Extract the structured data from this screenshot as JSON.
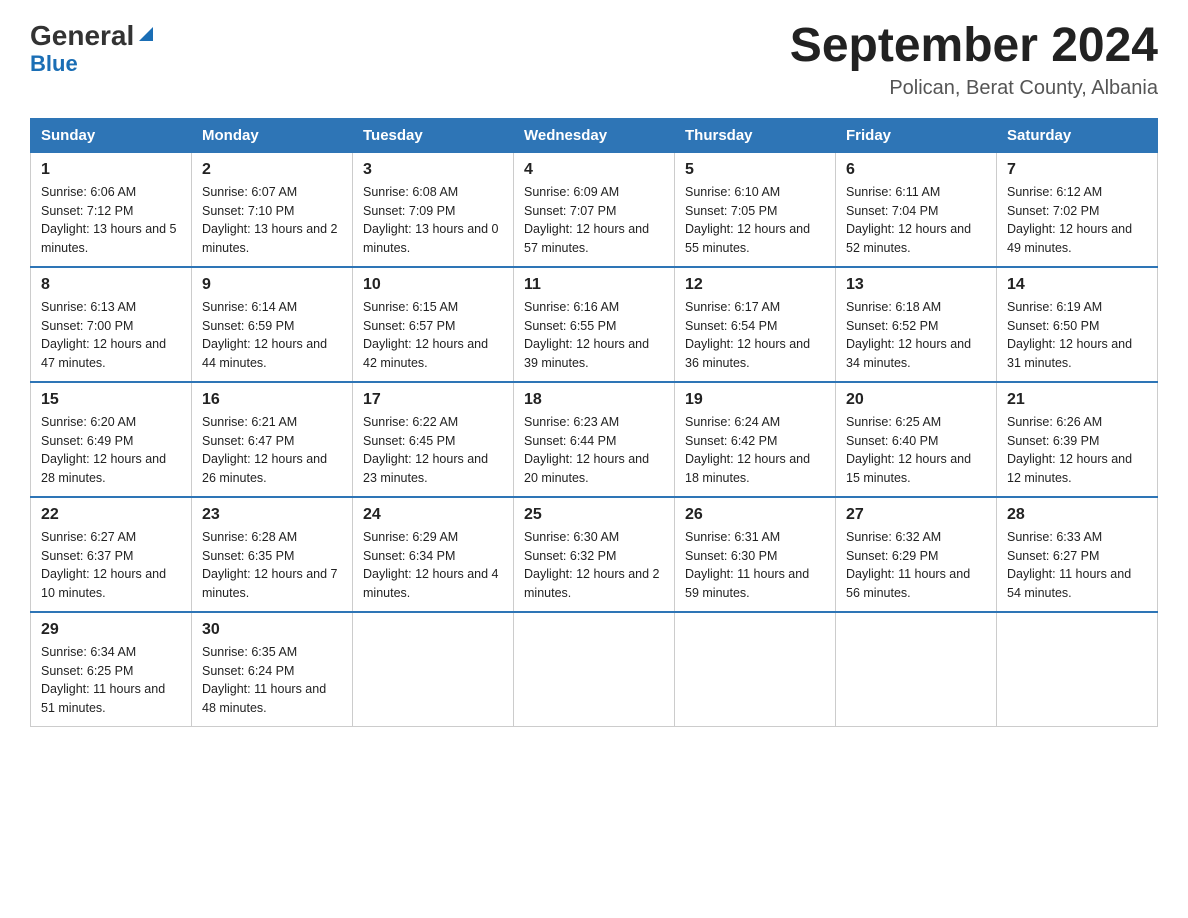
{
  "header": {
    "logo_general": "General",
    "logo_blue": "Blue",
    "title": "September 2024",
    "subtitle": "Polican, Berat County, Albania"
  },
  "calendar": {
    "days_of_week": [
      "Sunday",
      "Monday",
      "Tuesday",
      "Wednesday",
      "Thursday",
      "Friday",
      "Saturday"
    ],
    "weeks": [
      [
        {
          "day": "1",
          "sunrise": "6:06 AM",
          "sunset": "7:12 PM",
          "daylight": "13 hours and 5 minutes."
        },
        {
          "day": "2",
          "sunrise": "6:07 AM",
          "sunset": "7:10 PM",
          "daylight": "13 hours and 2 minutes."
        },
        {
          "day": "3",
          "sunrise": "6:08 AM",
          "sunset": "7:09 PM",
          "daylight": "13 hours and 0 minutes."
        },
        {
          "day": "4",
          "sunrise": "6:09 AM",
          "sunset": "7:07 PM",
          "daylight": "12 hours and 57 minutes."
        },
        {
          "day": "5",
          "sunrise": "6:10 AM",
          "sunset": "7:05 PM",
          "daylight": "12 hours and 55 minutes."
        },
        {
          "day": "6",
          "sunrise": "6:11 AM",
          "sunset": "7:04 PM",
          "daylight": "12 hours and 52 minutes."
        },
        {
          "day": "7",
          "sunrise": "6:12 AM",
          "sunset": "7:02 PM",
          "daylight": "12 hours and 49 minutes."
        }
      ],
      [
        {
          "day": "8",
          "sunrise": "6:13 AM",
          "sunset": "7:00 PM",
          "daylight": "12 hours and 47 minutes."
        },
        {
          "day": "9",
          "sunrise": "6:14 AM",
          "sunset": "6:59 PM",
          "daylight": "12 hours and 44 minutes."
        },
        {
          "day": "10",
          "sunrise": "6:15 AM",
          "sunset": "6:57 PM",
          "daylight": "12 hours and 42 minutes."
        },
        {
          "day": "11",
          "sunrise": "6:16 AM",
          "sunset": "6:55 PM",
          "daylight": "12 hours and 39 minutes."
        },
        {
          "day": "12",
          "sunrise": "6:17 AM",
          "sunset": "6:54 PM",
          "daylight": "12 hours and 36 minutes."
        },
        {
          "day": "13",
          "sunrise": "6:18 AM",
          "sunset": "6:52 PM",
          "daylight": "12 hours and 34 minutes."
        },
        {
          "day": "14",
          "sunrise": "6:19 AM",
          "sunset": "6:50 PM",
          "daylight": "12 hours and 31 minutes."
        }
      ],
      [
        {
          "day": "15",
          "sunrise": "6:20 AM",
          "sunset": "6:49 PM",
          "daylight": "12 hours and 28 minutes."
        },
        {
          "day": "16",
          "sunrise": "6:21 AM",
          "sunset": "6:47 PM",
          "daylight": "12 hours and 26 minutes."
        },
        {
          "day": "17",
          "sunrise": "6:22 AM",
          "sunset": "6:45 PM",
          "daylight": "12 hours and 23 minutes."
        },
        {
          "day": "18",
          "sunrise": "6:23 AM",
          "sunset": "6:44 PM",
          "daylight": "12 hours and 20 minutes."
        },
        {
          "day": "19",
          "sunrise": "6:24 AM",
          "sunset": "6:42 PM",
          "daylight": "12 hours and 18 minutes."
        },
        {
          "day": "20",
          "sunrise": "6:25 AM",
          "sunset": "6:40 PM",
          "daylight": "12 hours and 15 minutes."
        },
        {
          "day": "21",
          "sunrise": "6:26 AM",
          "sunset": "6:39 PM",
          "daylight": "12 hours and 12 minutes."
        }
      ],
      [
        {
          "day": "22",
          "sunrise": "6:27 AM",
          "sunset": "6:37 PM",
          "daylight": "12 hours and 10 minutes."
        },
        {
          "day": "23",
          "sunrise": "6:28 AM",
          "sunset": "6:35 PM",
          "daylight": "12 hours and 7 minutes."
        },
        {
          "day": "24",
          "sunrise": "6:29 AM",
          "sunset": "6:34 PM",
          "daylight": "12 hours and 4 minutes."
        },
        {
          "day": "25",
          "sunrise": "6:30 AM",
          "sunset": "6:32 PM",
          "daylight": "12 hours and 2 minutes."
        },
        {
          "day": "26",
          "sunrise": "6:31 AM",
          "sunset": "6:30 PM",
          "daylight": "11 hours and 59 minutes."
        },
        {
          "day": "27",
          "sunrise": "6:32 AM",
          "sunset": "6:29 PM",
          "daylight": "11 hours and 56 minutes."
        },
        {
          "day": "28",
          "sunrise": "6:33 AM",
          "sunset": "6:27 PM",
          "daylight": "11 hours and 54 minutes."
        }
      ],
      [
        {
          "day": "29",
          "sunrise": "6:34 AM",
          "sunset": "6:25 PM",
          "daylight": "11 hours and 51 minutes."
        },
        {
          "day": "30",
          "sunrise": "6:35 AM",
          "sunset": "6:24 PM",
          "daylight": "11 hours and 48 minutes."
        },
        null,
        null,
        null,
        null,
        null
      ]
    ],
    "labels": {
      "sunrise": "Sunrise:",
      "sunset": "Sunset:",
      "daylight": "Daylight:"
    }
  }
}
